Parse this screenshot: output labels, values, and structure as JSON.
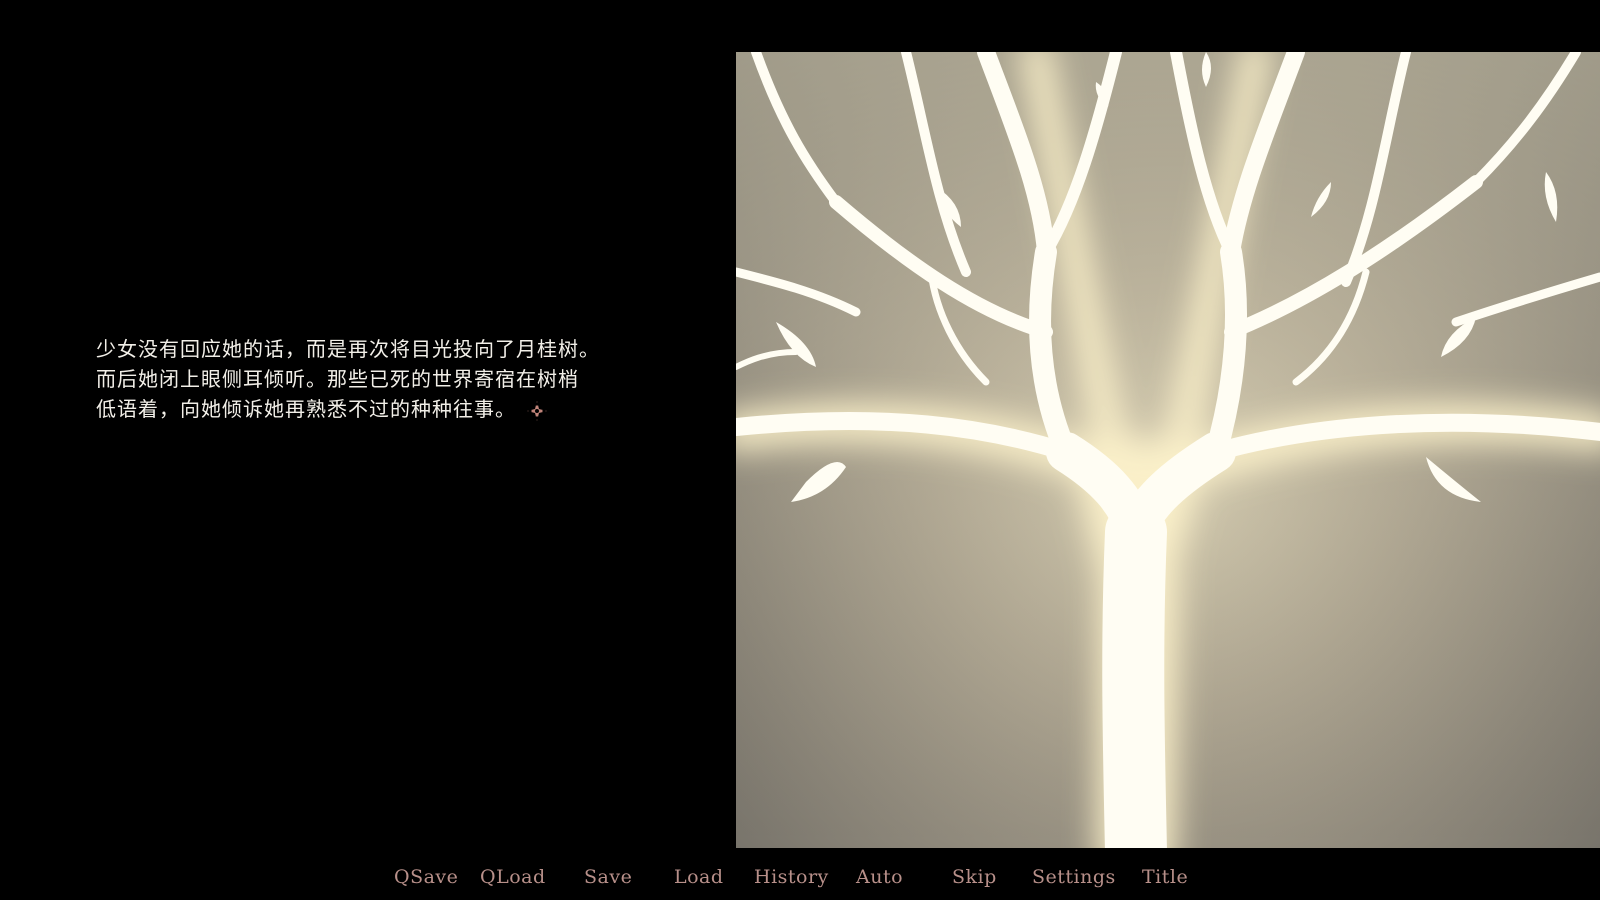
{
  "dialogue": {
    "lines": [
      "少女没有回应她的话，而是再次将目光投向了月桂树。",
      "而后她闭上眼侧耳倾听。那些已死的世界寄宿在树梢",
      "低语着，向她倾诉她再熟悉不过的种种往事。"
    ],
    "text_color": "#f2efe8",
    "ctc_icon": "four-point-sparkle-icon",
    "ctc_color": "#c0847a"
  },
  "scene": {
    "background_color": "#000000",
    "cg_subject": "glowing-white-tree-icon"
  },
  "quick_menu": {
    "text_color": "#b8908a",
    "items": [
      "QSave",
      "QLoad",
      "Save",
      "Load",
      "History",
      "Auto",
      "Skip",
      "Settings",
      "Title"
    ]
  }
}
